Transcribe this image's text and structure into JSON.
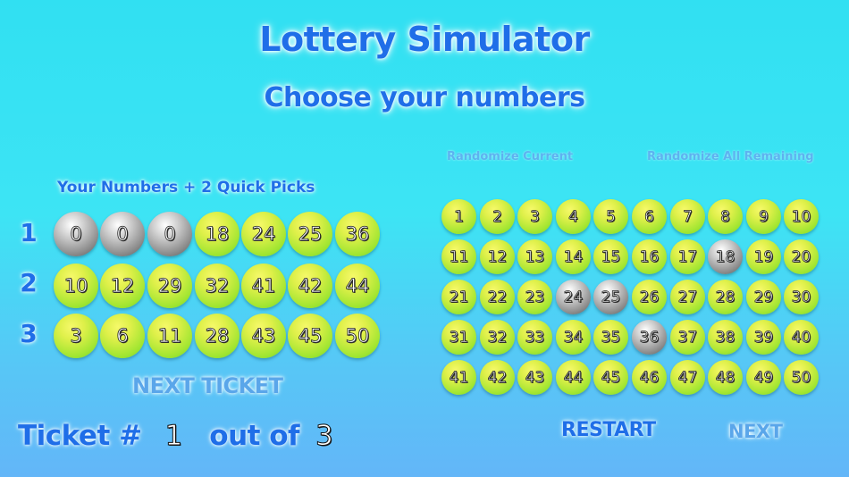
{
  "header": {
    "title": "Lottery Simulator",
    "subtitle": "Choose your numbers"
  },
  "actions": {
    "randomize_current": "Randomize Current",
    "randomize_all": "Randomize All Remaining",
    "next_ticket": "NEXT TICKET",
    "restart": "RESTART",
    "next": "NEXT"
  },
  "tickets": {
    "label": "Your Numbers + 2 Quick Picks",
    "rows": [
      {
        "label": "1",
        "balls": [
          {
            "n": "0",
            "state": "grey"
          },
          {
            "n": "0",
            "state": "grey"
          },
          {
            "n": "0",
            "state": "grey"
          },
          {
            "n": "18",
            "state": "green"
          },
          {
            "n": "24",
            "state": "green"
          },
          {
            "n": "25",
            "state": "green"
          },
          {
            "n": "36",
            "state": "green"
          }
        ]
      },
      {
        "label": "2",
        "balls": [
          {
            "n": "10",
            "state": "green"
          },
          {
            "n": "12",
            "state": "green"
          },
          {
            "n": "29",
            "state": "green"
          },
          {
            "n": "32",
            "state": "green"
          },
          {
            "n": "41",
            "state": "green"
          },
          {
            "n": "42",
            "state": "green"
          },
          {
            "n": "44",
            "state": "green"
          }
        ]
      },
      {
        "label": "3",
        "balls": [
          {
            "n": "3",
            "state": "green"
          },
          {
            "n": "6",
            "state": "green"
          },
          {
            "n": "11",
            "state": "green"
          },
          {
            "n": "28",
            "state": "green"
          },
          {
            "n": "43",
            "state": "green"
          },
          {
            "n": "45",
            "state": "green"
          },
          {
            "n": "50",
            "state": "green"
          }
        ]
      }
    ]
  },
  "ticket_status": {
    "prefix": "Ticket #",
    "current": "1",
    "middle": "out of",
    "total": "3"
  },
  "number_grid": {
    "numbers": [
      "1",
      "2",
      "3",
      "4",
      "5",
      "6",
      "7",
      "8",
      "9",
      "10",
      "11",
      "12",
      "13",
      "14",
      "15",
      "16",
      "17",
      "18",
      "19",
      "20",
      "21",
      "22",
      "23",
      "24",
      "25",
      "26",
      "27",
      "28",
      "29",
      "30",
      "31",
      "32",
      "33",
      "34",
      "35",
      "36",
      "37",
      "38",
      "39",
      "40",
      "41",
      "42",
      "43",
      "44",
      "45",
      "46",
      "47",
      "48",
      "49",
      "50"
    ],
    "selected": [
      "18",
      "24",
      "25",
      "36"
    ]
  },
  "colors": {
    "title_blue": "#1f6ee8",
    "muted_blue": "#5aa6ea",
    "ball_green": "#a3e632",
    "ball_grey": "#8c8c8c",
    "background": "#3de4f4"
  }
}
